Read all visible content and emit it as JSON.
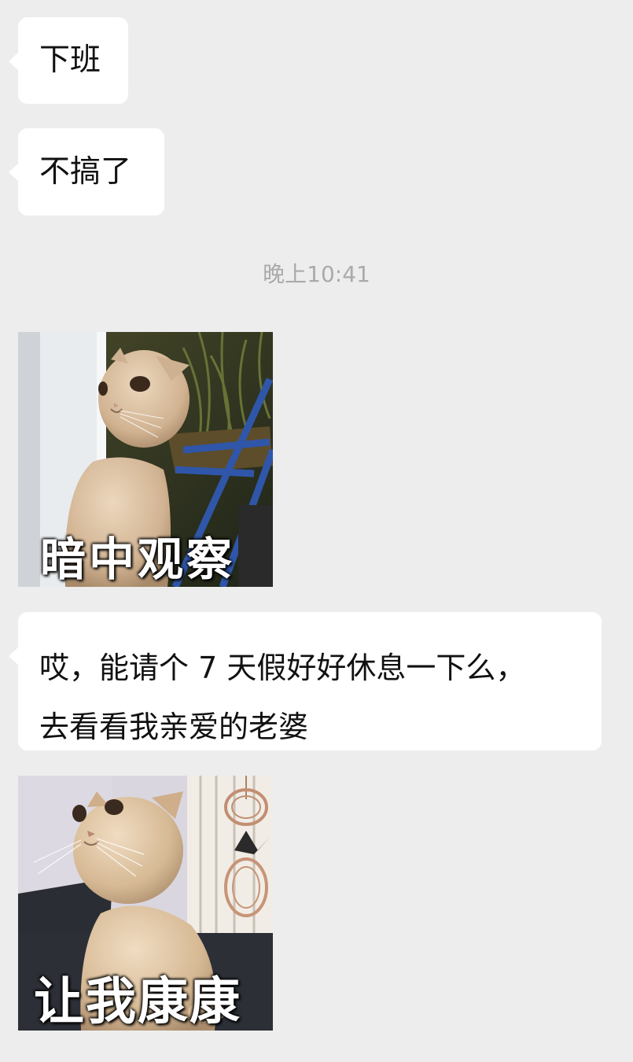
{
  "messages": [
    {
      "type": "text",
      "text": "下班"
    },
    {
      "type": "text",
      "text": "不搞了"
    },
    {
      "type": "timestamp",
      "text": "晚上10:41"
    },
    {
      "type": "sticker",
      "caption": "暗中观察",
      "subject": "scottish-fold-cat-peeking"
    },
    {
      "type": "text",
      "line1": "哎，能请个 7 天假好好休息一下么，",
      "line2": "去看看我亲爱的老婆"
    },
    {
      "type": "sticker",
      "caption": "让我康康",
      "subject": "scottish-fold-cat-looking"
    }
  ],
  "colors": {
    "background": "#EDEDED",
    "bubble": "#FFFFFF",
    "text": "#111111",
    "timestamp": "#AAAAAA"
  }
}
